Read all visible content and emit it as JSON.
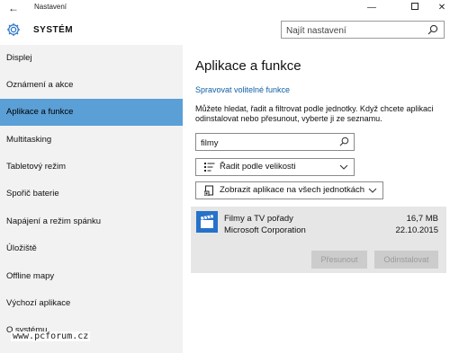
{
  "window": {
    "title": "Nastavení",
    "back_glyph": "←",
    "min_glyph": "—",
    "close_glyph": "✕"
  },
  "header": {
    "icon": "gear-icon",
    "title": "SYSTÉM",
    "search_placeholder": "Najít nastavení"
  },
  "sidebar": {
    "items": [
      {
        "label": "Displej",
        "active": false
      },
      {
        "label": "Oznámení a akce",
        "active": false
      },
      {
        "label": "Aplikace a funkce",
        "active": true
      },
      {
        "label": "Multitasking",
        "active": false
      },
      {
        "label": "Tabletový režim",
        "active": false
      },
      {
        "label": "Spořič baterie",
        "active": false
      },
      {
        "label": "Napájení a režim spánku",
        "active": false
      },
      {
        "label": "Úložiště",
        "active": false
      },
      {
        "label": "Offline mapy",
        "active": false
      },
      {
        "label": "Výchozí aplikace",
        "active": false
      },
      {
        "label": "O systému",
        "active": false
      }
    ]
  },
  "main": {
    "title": "Aplikace a funkce",
    "manage_link": "Spravovat volitelné funkce",
    "description": "Můžete hledat, řadit a filtrovat podle jednotky. Když chcete aplikaci odinstalovat nebo přesunout, vyberte ji ze seznamu.",
    "filter_value": "filmy",
    "sort_label": "Řadit podle velikosti",
    "drive_label": "Zobrazit aplikace na všech jednotkách"
  },
  "app": {
    "name": "Filmy a TV pořady",
    "publisher": "Microsoft Corporation",
    "size": "16,7 MB",
    "date": "22.10.2015",
    "move_button": "Přesunout",
    "uninstall_button": "Odinstalovat"
  },
  "watermark": "www.pcforum.cz",
  "colors": {
    "accent": "#5a9fd6",
    "sidebar_bg": "#f2f2f2",
    "link": "#0f5fa8",
    "app_tile": "#2672c9",
    "card_bg": "#e6e6e6"
  }
}
